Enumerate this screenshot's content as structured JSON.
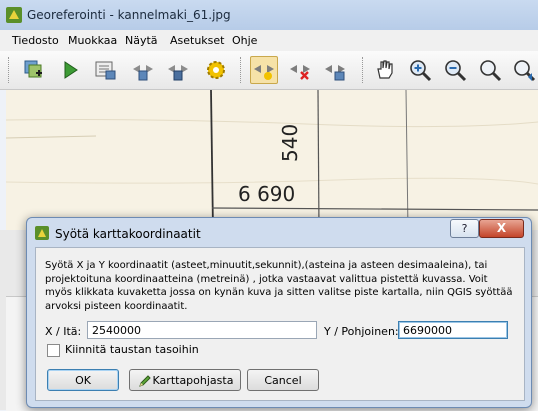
{
  "window": {
    "title": "Georeferointi - kannelmaki_61.jpg"
  },
  "menu": [
    "Tiedosto",
    "Muokkaa",
    "Näytä",
    "Asetukset",
    "Ohje"
  ],
  "toolbar": {
    "icons": [
      "open-raster-icon",
      "start-georeferencing-icon",
      "generate-gdal-script-icon",
      "load-gcp-icon",
      "save-gcp-icon",
      "transformation-settings-icon",
      "add-point-icon",
      "delete-point-icon",
      "move-point-icon",
      "pan-icon",
      "zoom-in-icon",
      "zoom-out-icon",
      "zoom-to-layer-icon",
      "zoom-last-icon"
    ]
  },
  "map": {
    "label_vertical": "540",
    "label_horizontal": "6 690"
  },
  "dialog": {
    "title": "Syötä karttakoordinaatit",
    "help_label": "?",
    "close_label": "X",
    "description": "Syötä X ja Y koordinaatit (asteet,minuutit,sekunnit),(asteina ja asteen desimaaleina), tai projektoituna koordinaatteina (metreinä) , jotka vastaavat valittua pistettä kuvassa. Voit myös klikkata kuvaketta jossa on kynän kuva ja sitten valitse piste kartalla, niin QGIS syöttää arvoksi pisteen koordinaatit.",
    "x_label": "X / Itä:",
    "x_value": "2540000",
    "y_label": "Y / Pohjoinen:",
    "y_value": "6690000",
    "snap_label": "Kiinnitä taustan tasoihin",
    "snap_checked": false,
    "ok_label": "OK",
    "from_canvas_label": "Karttapohjasta",
    "cancel_label": "Cancel"
  }
}
